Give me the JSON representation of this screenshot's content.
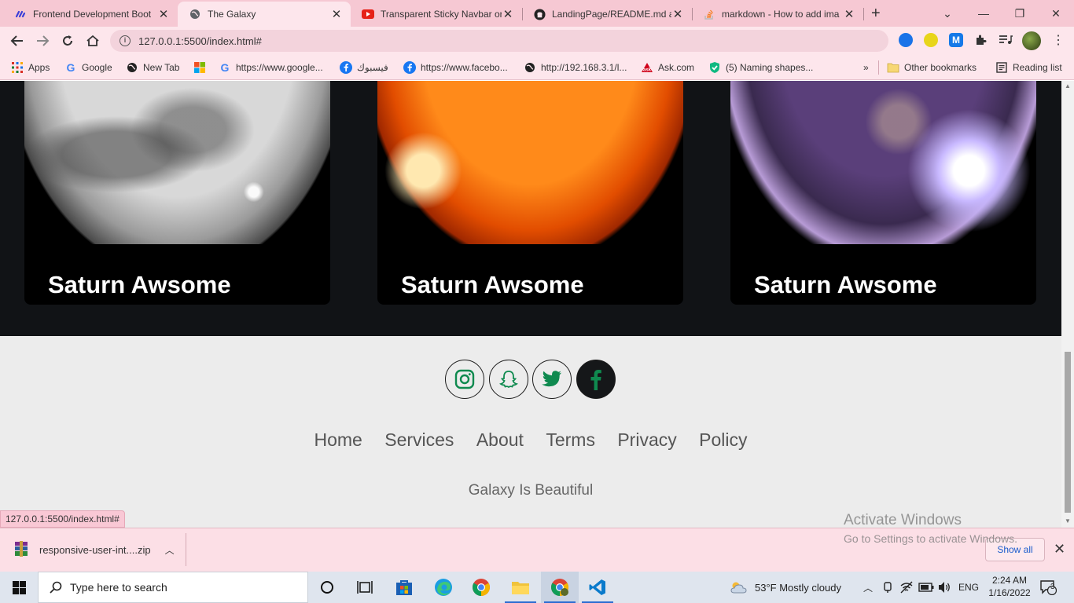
{
  "browser": {
    "tabs": [
      {
        "title": "Frontend Development Boot",
        "icon": "bootcamp-icon"
      },
      {
        "title": "The Galaxy",
        "icon": "globe-icon",
        "active": true
      },
      {
        "title": "Transparent Sticky Navbar or",
        "icon": "youtube-icon"
      },
      {
        "title": "LandingPage/README.md at",
        "icon": "github-icon"
      },
      {
        "title": "markdown - How to add ima",
        "icon": "stackoverflow-icon"
      }
    ],
    "url": "127.0.0.1:5500/index.html#",
    "bookmarks": [
      {
        "label": "Apps",
        "icon": "apps-grid-icon"
      },
      {
        "label": "Google",
        "icon": "google-icon"
      },
      {
        "label": "New Tab",
        "icon": "globe-icon"
      },
      {
        "label": "",
        "icon": "microsoft-icon"
      },
      {
        "label": "https://www.google...",
        "icon": "google-icon"
      },
      {
        "label": "فيسبوك",
        "icon": "facebook-icon"
      },
      {
        "label": "https://www.facebo...",
        "icon": "facebook-icon"
      },
      {
        "label": "http://192.168.3.1/l...",
        "icon": "globe-icon"
      },
      {
        "label": "Ask.com",
        "icon": "ask-icon"
      },
      {
        "label": "(5) Naming shapes...",
        "icon": "shield-check-icon"
      }
    ],
    "other_bookmarks": "Other bookmarks",
    "reading_list": "Reading list",
    "overflow": "»"
  },
  "page": {
    "cards": [
      {
        "caption": "Saturn Awsome",
        "image": "moon-surface"
      },
      {
        "caption": "Saturn Awsome",
        "image": "sun-surface"
      },
      {
        "caption": "Saturn Awsome",
        "image": "solar-flare"
      }
    ],
    "social": [
      "instagram-icon",
      "snapchat-icon",
      "twitter-icon",
      "facebook-icon"
    ],
    "footer_nav": [
      "Home",
      "Services",
      "About",
      "Terms",
      "Privacy",
      "Policy"
    ],
    "tagline": "Galaxy Is Beautiful",
    "status_url": "127.0.0.1:5500/index.html#"
  },
  "download": {
    "filename": "responsive-user-int....zip",
    "show_all": "Show all"
  },
  "activation": {
    "title": "Activate Windows",
    "subtitle": "Go to Settings to activate Windows."
  },
  "taskbar": {
    "search_placeholder": "Type here to search",
    "weather": "53°F  Mostly cloudy",
    "language": "ENG",
    "time": "2:24 AM",
    "date": "1/16/2022",
    "notification_count": "3"
  },
  "colors": {
    "tab_strip": "#f6c8d3",
    "toolbar": "#fde6ec",
    "dark_section": "#111316",
    "footer_bg": "#ececec",
    "social_green": "#0f8a4f"
  }
}
